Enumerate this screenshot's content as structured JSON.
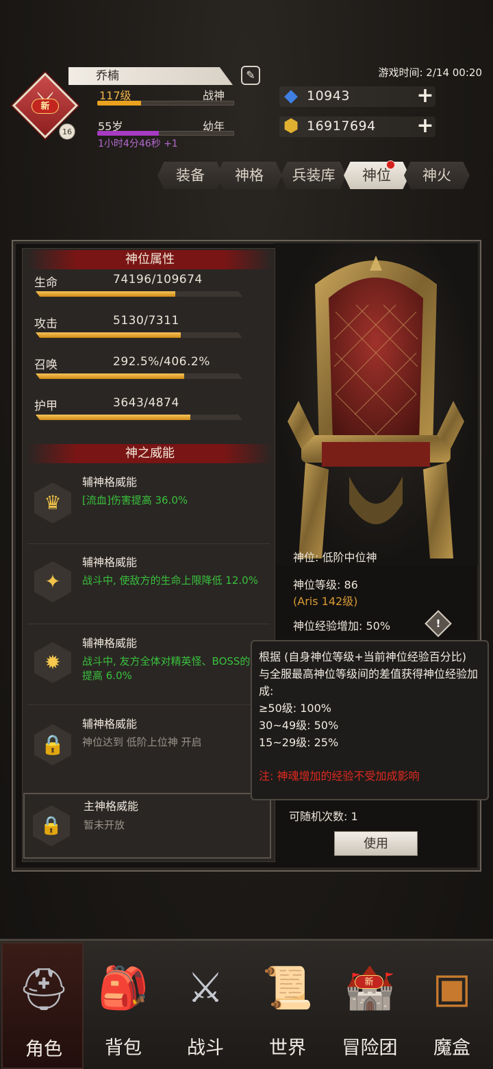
{
  "player": {
    "name": "乔楠",
    "level": "117级",
    "title": "战神",
    "age": "55岁",
    "age_stage": "幼年",
    "timer": "1小时4分46秒 +1",
    "badge_new": "新",
    "badge_level": "16",
    "level_progress": 0.32,
    "age_progress": 0.45
  },
  "game_time": "游戏时间: 2/14 00:20",
  "currencies": [
    {
      "icon": "blue-gem-icon",
      "value": "10943"
    },
    {
      "icon": "gold-coin-icon",
      "value": "16917694"
    }
  ],
  "tabs": [
    {
      "label": "装备"
    },
    {
      "label": "神格"
    },
    {
      "label": "兵装库"
    },
    {
      "label": "神位"
    },
    {
      "label": "神火"
    }
  ],
  "active_tab": "神位",
  "attributes": {
    "title": "神位属性",
    "items": [
      {
        "label": "生命",
        "value": "74196/109674",
        "progress": 0.677
      },
      {
        "label": "攻击",
        "value": "5130/7311",
        "progress": 0.702
      },
      {
        "label": "召唤",
        "value": "292.5%/406.2%",
        "progress": 0.72
      },
      {
        "label": "护甲",
        "value": "3643/4874",
        "progress": 0.747
      }
    ]
  },
  "powers": {
    "title": "神之威能",
    "items": [
      {
        "title": "辅神格威能",
        "desc": "[流血]伤害提高 36.0%",
        "icon": "crown-icon",
        "locked": false
      },
      {
        "title": "辅神格威能",
        "desc": "战斗中, 使敌方的生命上限降低 12.0%",
        "icon": "triquetra-icon",
        "locked": false
      },
      {
        "title": "辅神格威能",
        "desc": "战斗中, 友方全体对精英怪、BOSS的伤害提高 6.0%",
        "icon": "sun-icon",
        "locked": false
      },
      {
        "title": "辅神格威能",
        "desc": "神位达到 低阶上位神 开启",
        "icon": "lock-icon",
        "locked": true
      }
    ],
    "main": {
      "title": "主神格威能",
      "desc": "暂未开放",
      "icon": "lock-icon"
    }
  },
  "god_position": {
    "rank": "神位: 低阶中位神",
    "level": "神位等级: 86",
    "aris": "(Aris 142级)",
    "exp_bonus": "神位经验增加: 50%"
  },
  "tooltip": {
    "lines": [
      "根据 (自身神位等级+当前神位经验百分比) 与全服最高神位等级间的差值获得神位经验加成:",
      "≥50级: 100%",
      "30~49级: 50%",
      "15~29级: 25%"
    ],
    "note": "注: 神魂增加的经验不受加成影响"
  },
  "roll": {
    "text": "可随机次数: 1",
    "button": "使用"
  },
  "nav": [
    {
      "label": "角色",
      "icon": "helmet-icon"
    },
    {
      "label": "背包",
      "icon": "backpack-icon"
    },
    {
      "label": "战斗",
      "icon": "sword-shield-icon"
    },
    {
      "label": "世界",
      "icon": "scroll-map-icon"
    },
    {
      "label": "冒险团",
      "icon": "castle-icon",
      "badge": "新"
    },
    {
      "label": "魔盒",
      "icon": "magic-box-icon"
    }
  ]
}
